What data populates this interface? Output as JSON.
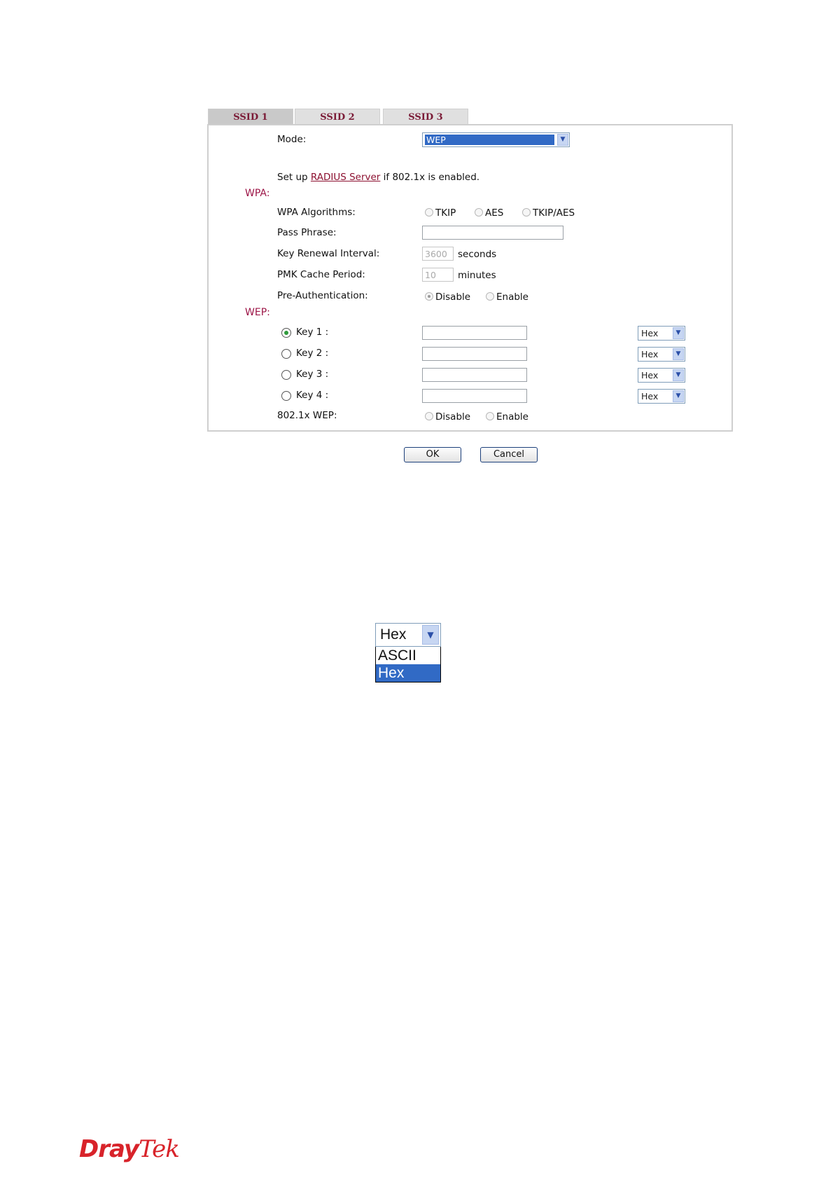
{
  "tabs": [
    "SSID 1",
    "SSID 2",
    "SSID 3"
  ],
  "mode": {
    "label": "Mode:",
    "value": "WEP"
  },
  "radius_note": {
    "prefix": "Set up ",
    "link": "RADIUS Server",
    "suffix": " if 802.1x is enabled."
  },
  "wpa": {
    "title": "WPA:",
    "algorithms": {
      "label": "WPA Algorithms:",
      "options": [
        "TKIP",
        "AES",
        "TKIP/AES"
      ]
    },
    "pass_phrase": {
      "label": "Pass Phrase:",
      "value": ""
    },
    "key_renewal": {
      "label": "Key Renewal Interval:",
      "value": "3600",
      "unit": "seconds"
    },
    "pmk_cache": {
      "label": "PMK Cache Period:",
      "value": "10",
      "unit": "minutes"
    },
    "pre_auth": {
      "label": "Pre-Authentication:",
      "options": [
        "Disable",
        "Enable"
      ],
      "selected": "Disable"
    }
  },
  "wep": {
    "title": "WEP:",
    "keys": [
      {
        "label": "Key 1 :",
        "value": "",
        "format": "Hex",
        "selected": true
      },
      {
        "label": "Key 2 :",
        "value": "",
        "format": "Hex",
        "selected": false
      },
      {
        "label": "Key 3 :",
        "value": "",
        "format": "Hex",
        "selected": false
      },
      {
        "label": "Key 4 :",
        "value": "",
        "format": "Hex",
        "selected": false
      }
    ],
    "dot1x_wep": {
      "label": "802.1x WEP:",
      "options": [
        "Disable",
        "Enable"
      ]
    }
  },
  "buttons": {
    "ok": "OK",
    "cancel": "Cancel"
  },
  "dropdown_example": {
    "current": "Hex",
    "options": [
      "ASCII",
      "Hex"
    ],
    "highlighted": "Hex"
  },
  "logo": {
    "part1": "Dray",
    "part2": "Tek"
  },
  "colors": {
    "section_title": "#9c1446",
    "tab_text": "#7a1a36",
    "highlight": "#316ac5",
    "logo": "#d8232a"
  }
}
